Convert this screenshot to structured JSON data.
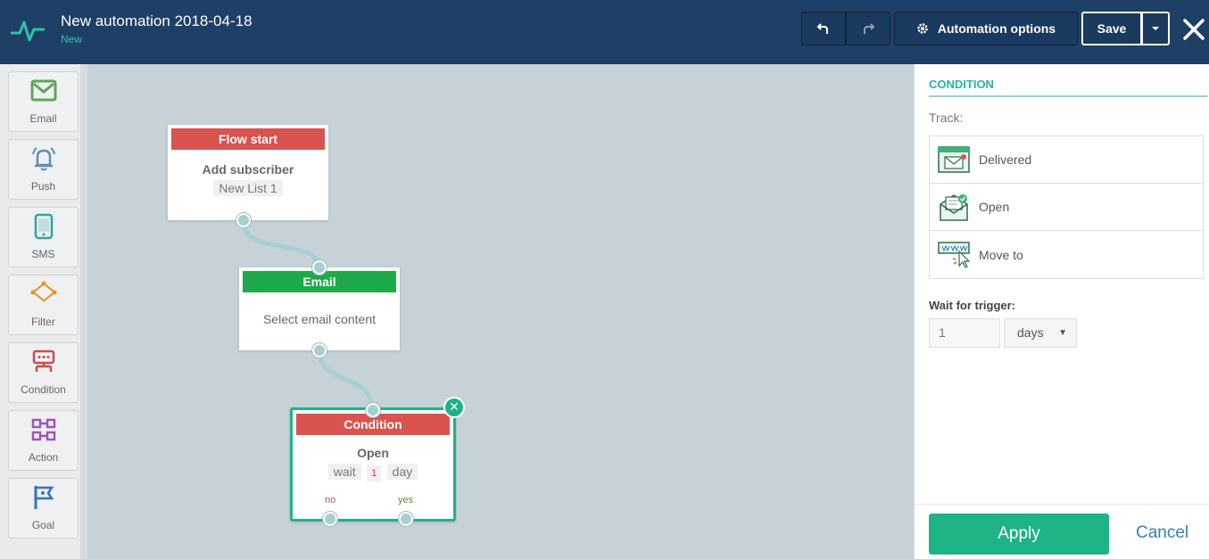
{
  "header": {
    "title": "New automation 2018-04-18",
    "status": "New",
    "automation_options_label": "Automation options",
    "save_label": "Save"
  },
  "toolbar": {
    "items": [
      {
        "label": "Email",
        "icon": "envelope-icon",
        "color": "#5fa55a"
      },
      {
        "label": "Push",
        "icon": "bell-icon",
        "color": "#5b8fb9"
      },
      {
        "label": "SMS",
        "icon": "phone-icon",
        "color": "#2aa8a0"
      },
      {
        "label": "Filter",
        "icon": "filter-branch-icon",
        "color": "#e0952b"
      },
      {
        "label": "Condition",
        "icon": "condition-icon",
        "color": "#c84f4f"
      },
      {
        "label": "Action",
        "icon": "action-icon",
        "color": "#9b59b6"
      },
      {
        "label": "Goal",
        "icon": "flag-icon",
        "color": "#3a72b5"
      }
    ]
  },
  "canvas": {
    "flow_start": {
      "header": "Flow start",
      "title": "Add subscriber",
      "list": "New List 1",
      "color": "#d9534f"
    },
    "email": {
      "header": "Email",
      "text": "Select email content",
      "color": "#1eaa4a"
    },
    "condition": {
      "header": "Condition",
      "title": "Open",
      "wait_label": "wait",
      "wait_value": "1",
      "wait_unit": "day",
      "no_label": "no",
      "yes_label": "yes",
      "color": "#d9534f"
    }
  },
  "panel": {
    "title": "CONDITION",
    "track_label": "Track:",
    "track_items": [
      {
        "label": "Delivered",
        "icon": "delivered-email-icon"
      },
      {
        "label": "Open",
        "icon": "open-email-icon"
      },
      {
        "label": "Move to",
        "icon": "click-link-icon"
      }
    ],
    "wait_label": "Wait for trigger:",
    "wait_value": "1",
    "wait_unit": "days",
    "apply_label": "Apply",
    "cancel_label": "Cancel"
  },
  "colors": {
    "header_bg": "#1e3f66",
    "accent": "#1eb386",
    "panel_title": "#22b3a8"
  }
}
